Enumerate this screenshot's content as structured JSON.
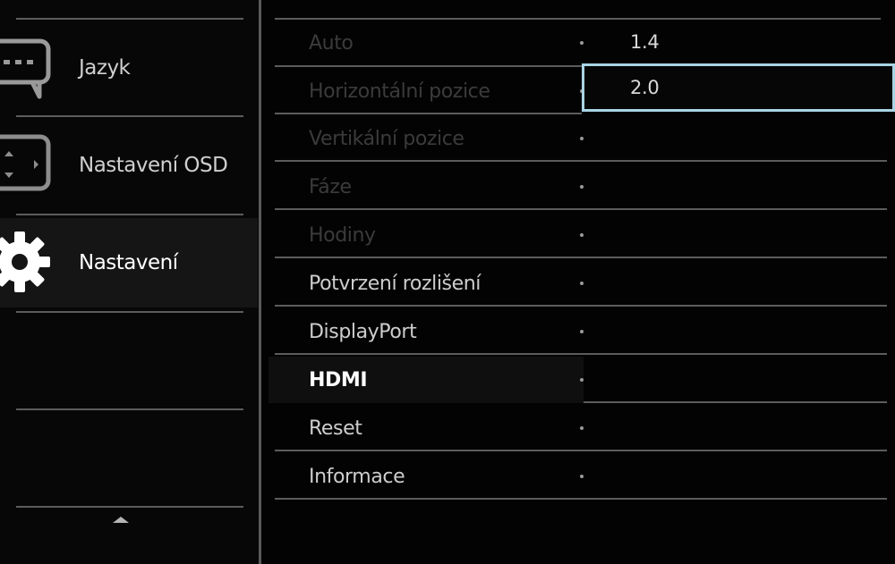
{
  "sidebar": {
    "items": [
      {
        "label": "Jazyk",
        "icon": "language-speech-icon"
      },
      {
        "label": "Nastavení OSD",
        "icon": "osd-settings-icon"
      },
      {
        "label": "Nastavení",
        "icon": "gear-icon",
        "active": true
      }
    ],
    "scroll_up_icon": "triangle-up-icon"
  },
  "menu": {
    "items": [
      {
        "label": "Auto",
        "state": "disabled"
      },
      {
        "label": "Horizontální pozice",
        "state": "disabled"
      },
      {
        "label": "Vertikální pozice",
        "state": "disabled"
      },
      {
        "label": "Fáze",
        "state": "disabled"
      },
      {
        "label": "Hodiny",
        "state": "disabled"
      },
      {
        "label": "Potvrzení rozlišení",
        "state": "enabled"
      },
      {
        "label": "DisplayPort",
        "state": "enabled"
      },
      {
        "label": "HDMI",
        "state": "active"
      },
      {
        "label": "Reset",
        "state": "enabled"
      },
      {
        "label": "Informace",
        "state": "enabled"
      }
    ]
  },
  "submenu": {
    "options": [
      {
        "label": "1.4"
      },
      {
        "label": "2.0",
        "selected": true
      }
    ]
  },
  "colors": {
    "background": "#030303",
    "selection_border": "#a9d4e4",
    "divider": "#5c5c5c"
  }
}
